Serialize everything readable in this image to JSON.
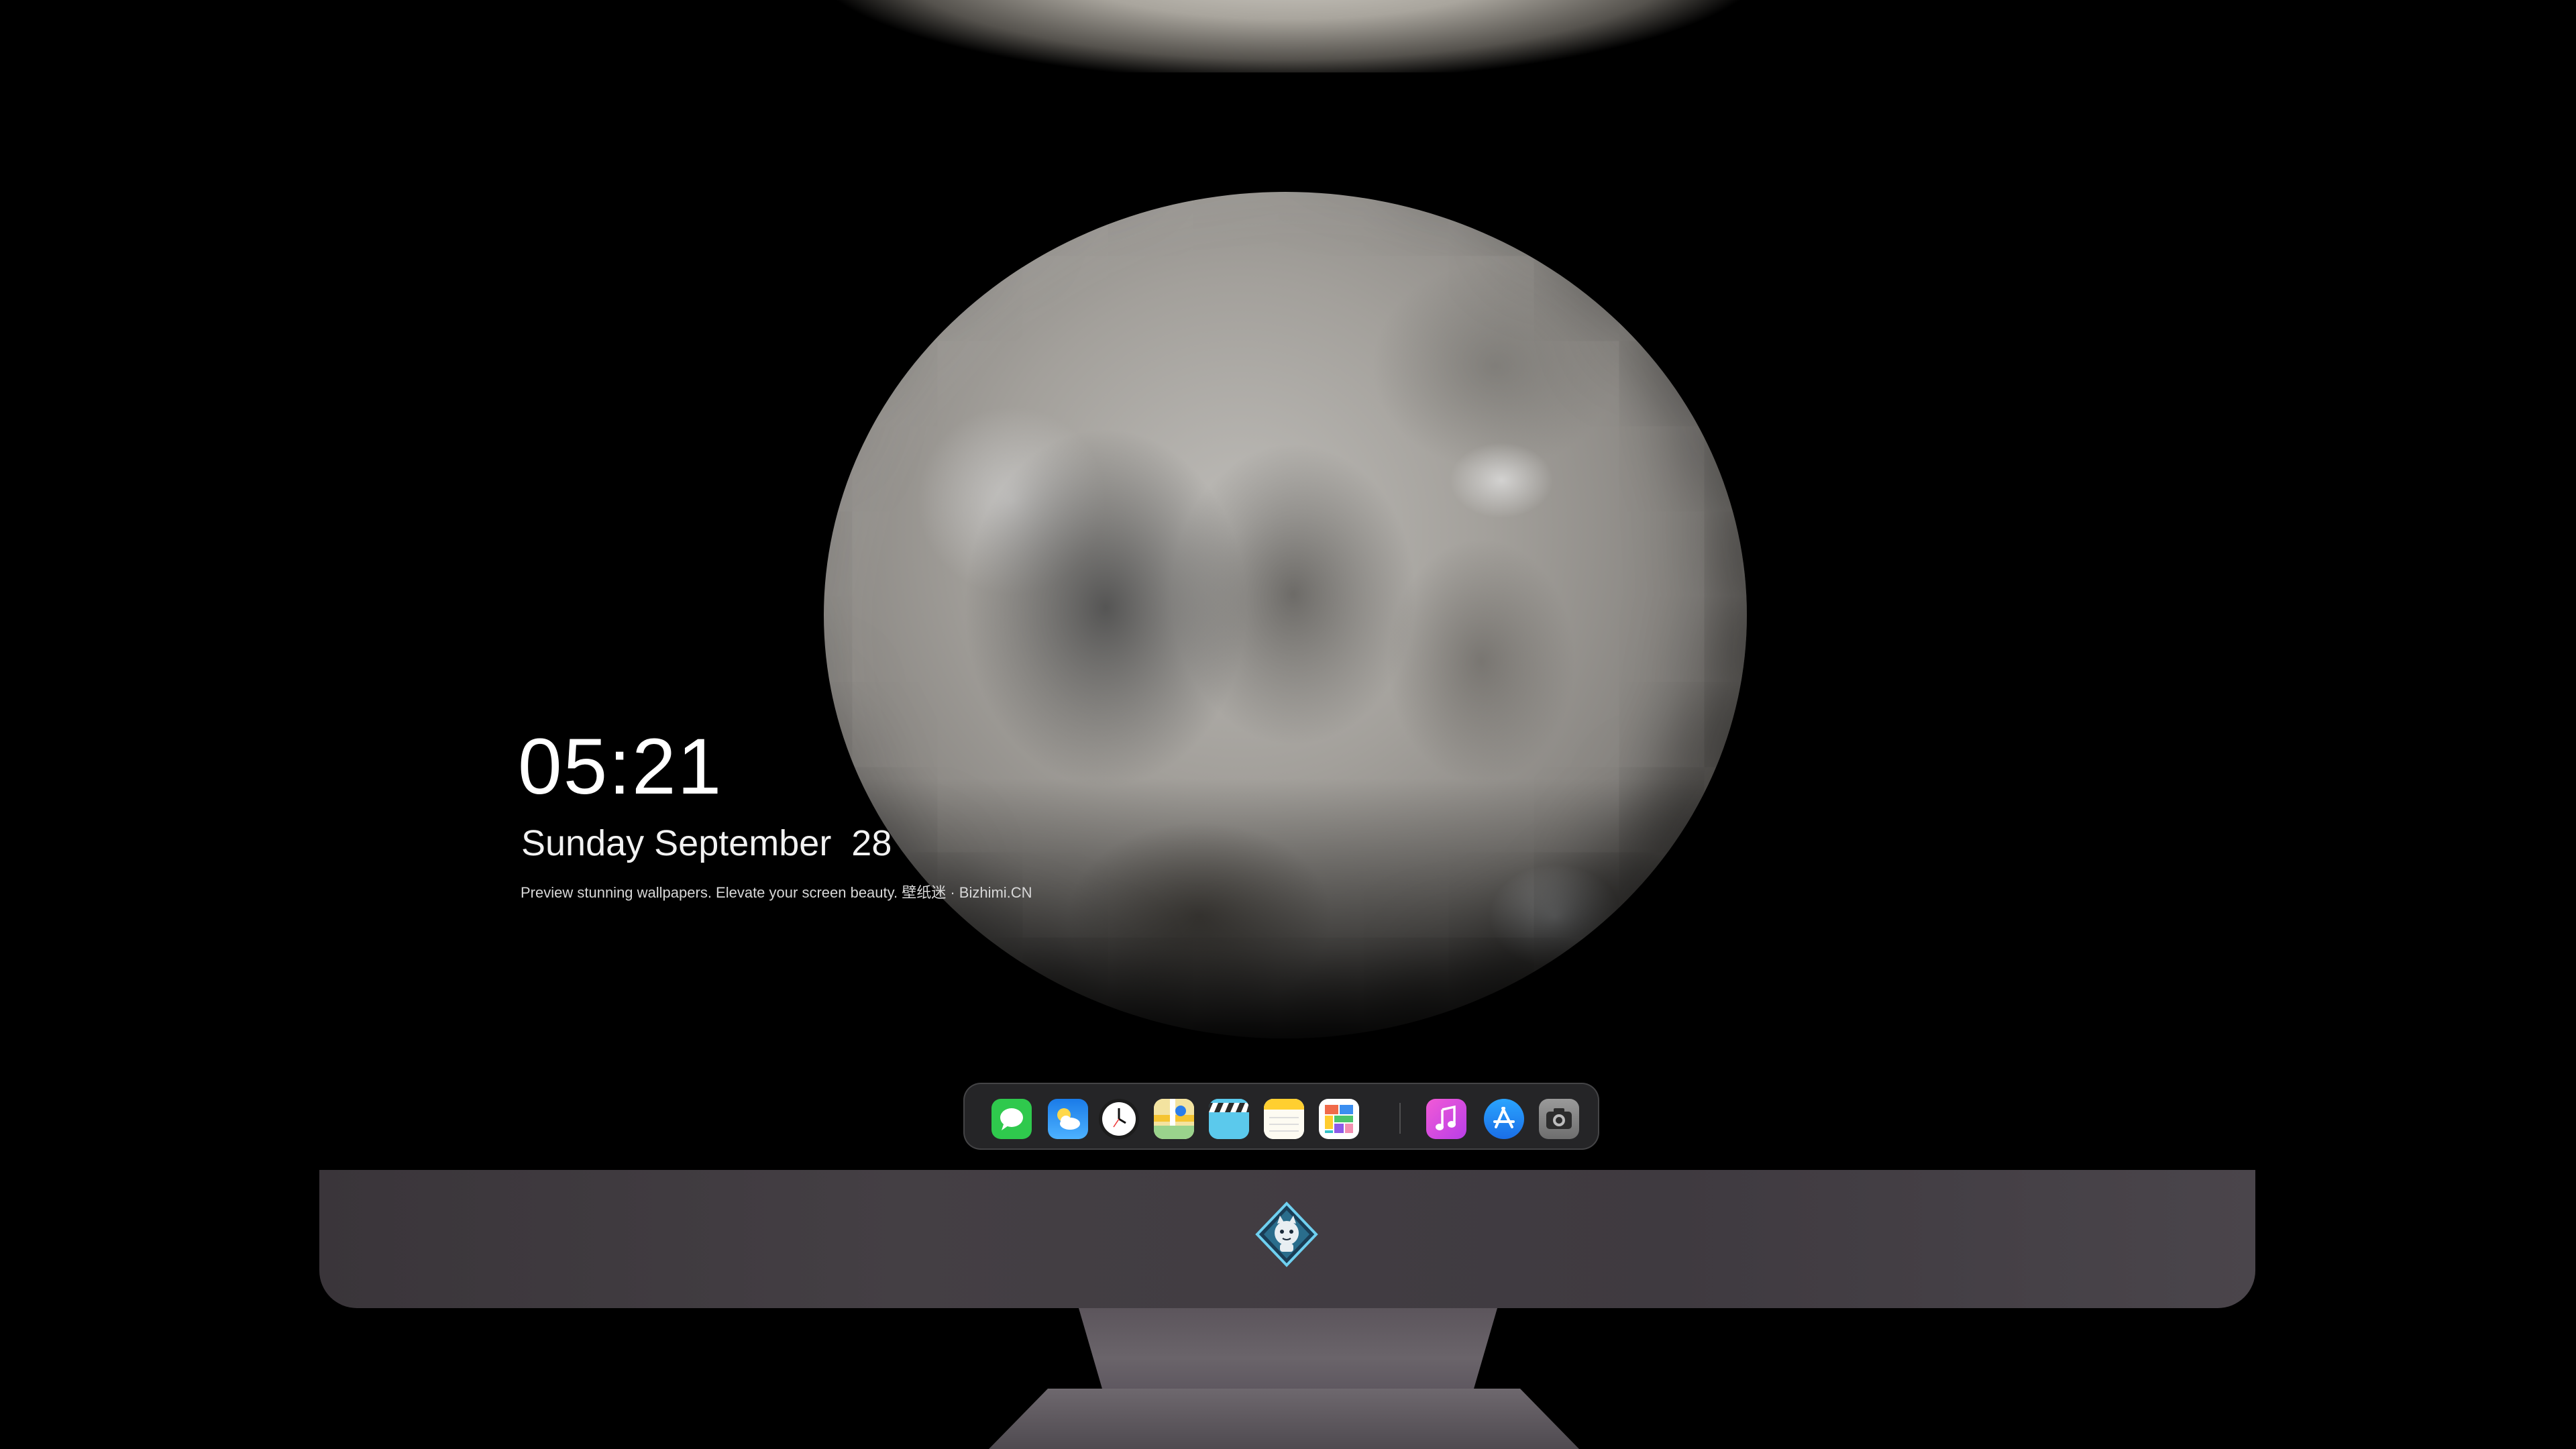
{
  "lockscreen": {
    "time": "05:21",
    "date": "Sunday September  28",
    "caption": "Preview stunning wallpapers. Elevate your screen beauty. 壁纸迷 · Bizhimi.CN"
  },
  "dock": {
    "items": [
      {
        "name": "messages-icon",
        "label": "Messages",
        "color": "#2fc94d"
      },
      {
        "name": "weather-icon",
        "label": "Weather",
        "color": "#1e8ef0"
      },
      {
        "name": "clock-icon",
        "label": "Clock",
        "color": "#ffffff"
      },
      {
        "name": "maps-icon",
        "label": "Maps",
        "color": "#f5d35a"
      },
      {
        "name": "video-clapper-icon",
        "label": "Videos",
        "color": "#4fc3e8"
      },
      {
        "name": "notes-icon",
        "label": "Notes",
        "color": "#ffd84a"
      },
      {
        "name": "photos-grid-icon",
        "label": "Photos",
        "color": "#ffffff"
      },
      {
        "name": "music-icon",
        "label": "Music",
        "color": "#e046c8"
      },
      {
        "name": "app-store-icon",
        "label": "App Store",
        "color": "#1f8cf5"
      },
      {
        "name": "camera-icon",
        "label": "Camera",
        "color": "#8a8a8a"
      }
    ]
  },
  "monitor": {
    "logo": "mascot-logo-icon"
  },
  "colors": {
    "background": "#000000",
    "monitor_chin": "#403b41",
    "dock_bg": "#28282a"
  }
}
